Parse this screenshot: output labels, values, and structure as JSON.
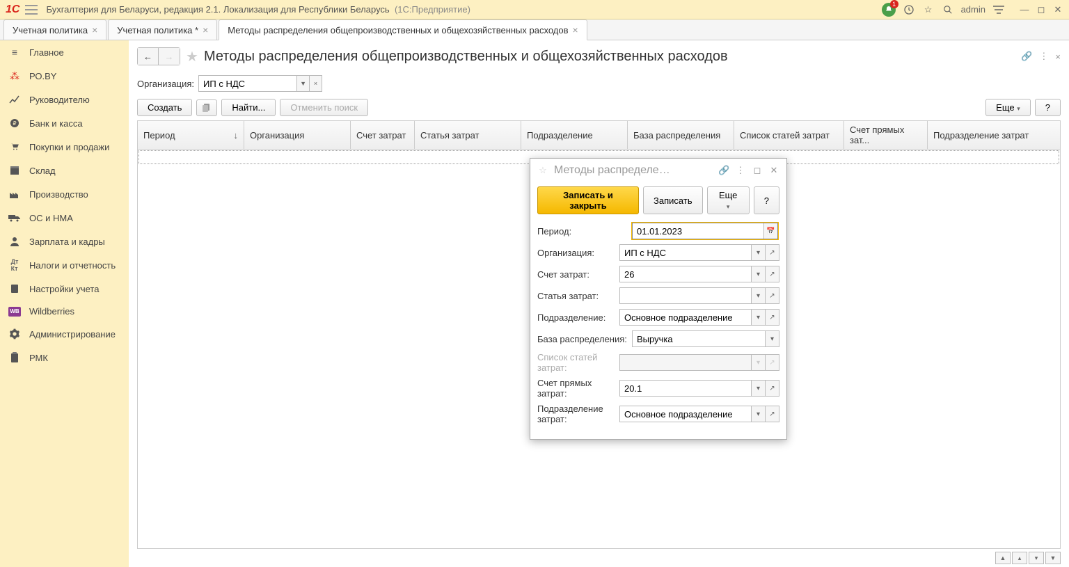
{
  "titlebar": {
    "app_title": "Бухгалтерия для Беларуси, редакция 2.1. Локализация для Республики Беларусь",
    "app_suffix": "(1С:Предприятие)",
    "user": "admin"
  },
  "tabs": [
    {
      "label": "Учетная политика"
    },
    {
      "label": "Учетная политика *"
    },
    {
      "label": "Методы распределения общепроизводственных и общехозяйственных расходов"
    }
  ],
  "sidebar": [
    {
      "label": "Главное",
      "icon": "menu"
    },
    {
      "label": "РО.BY",
      "icon": "dots"
    },
    {
      "label": "Руководителю",
      "icon": "chart"
    },
    {
      "label": "Банк и касса",
      "icon": "coin"
    },
    {
      "label": "Покупки и продажи",
      "icon": "cart"
    },
    {
      "label": "Склад",
      "icon": "box"
    },
    {
      "label": "Производство",
      "icon": "factory"
    },
    {
      "label": "ОС и НМА",
      "icon": "truck"
    },
    {
      "label": "Зарплата и кадры",
      "icon": "person"
    },
    {
      "label": "Налоги и отчетность",
      "icon": "dk"
    },
    {
      "label": "Настройки учета",
      "icon": "book"
    },
    {
      "label": "Wildberries",
      "icon": "wb"
    },
    {
      "label": "Администрирование",
      "icon": "gear"
    },
    {
      "label": "РМК",
      "icon": "clip"
    }
  ],
  "page": {
    "title": "Методы распределения общепроизводственных и общехозяйственных расходов",
    "filter_label": "Организация:",
    "filter_value": "ИП с НДС",
    "create_btn": "Создать",
    "find_btn": "Найти...",
    "cancel_find_btn": "Отменить поиск",
    "more_btn": "Еще",
    "help_btn": "?",
    "columns": [
      "Период",
      "Организация",
      "Счет затрат",
      "Статья затрат",
      "Подразделение",
      "База распределения",
      "Список статей затрат",
      "Счет прямых зат...",
      "Подразделение затрат"
    ]
  },
  "modal": {
    "title": "Методы распределе…",
    "save_close_btn": "Записать и закрыть",
    "save_btn": "Записать",
    "more_btn": "Еще",
    "help_btn": "?",
    "fields": {
      "period_label": "Период:",
      "period_value": "01.01.2023",
      "org_label": "Организация:",
      "org_value": "ИП с НДС",
      "account_label": "Счет затрат:",
      "account_value": "26",
      "article_label": "Статья затрат:",
      "article_value": "",
      "dept_label": "Подразделение:",
      "dept_value": "Основное подразделение",
      "base_label": "База распределения:",
      "base_value": "Выручка",
      "list_label": "Список статей затрат:",
      "list_value": "",
      "direct_label": "Счет прямых затрат:",
      "direct_value": "20.1",
      "dept2_label": "Подразделение затрат:",
      "dept2_value": "Основное подразделение"
    }
  }
}
